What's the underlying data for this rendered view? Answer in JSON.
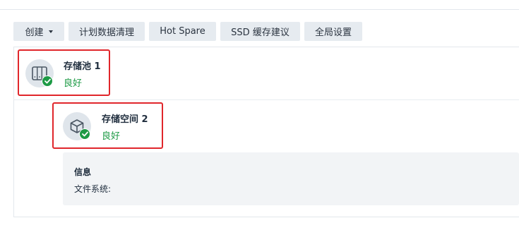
{
  "toolbar": {
    "create_label": "创建",
    "schedule_cleanup_label": "计划数据清理",
    "hot_spare_label": "Hot Spare",
    "ssd_cache_label": "SSD 缓存建议",
    "global_settings_label": "全局设置"
  },
  "storage_pool": {
    "title": "存储池 1",
    "status": "良好",
    "icon": "disk-array-icon"
  },
  "volume": {
    "title": "存储空间 2",
    "status": "良好",
    "icon": "cube-icon"
  },
  "info": {
    "title": "信息",
    "filesystem_label": "文件系统:"
  },
  "colors": {
    "status_good": "#1d9a45",
    "highlight": "#e0262b",
    "button_bg": "#e6ebf0"
  }
}
